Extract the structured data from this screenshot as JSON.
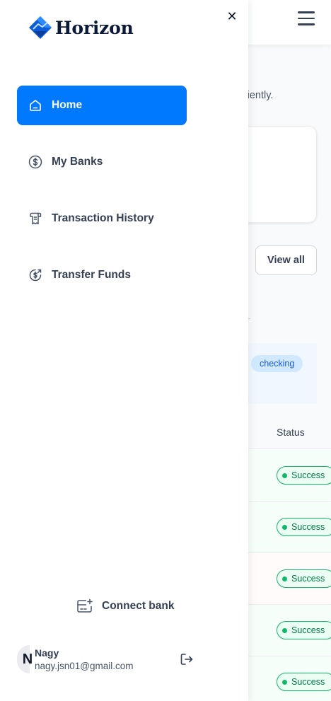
{
  "app": {
    "brand": "Horizon"
  },
  "background": {
    "subtitle_fragment": "s efficiently.",
    "view_all_label": "View all",
    "account_badge": "checking",
    "table_status_header": "Status",
    "rows": [
      {
        "status": "Success"
      },
      {
        "status": "Success"
      },
      {
        "status": "Success"
      },
      {
        "status": "Success"
      },
      {
        "status": "Success"
      }
    ]
  },
  "sidebar": {
    "items": [
      {
        "label": "Home",
        "icon": "home-icon",
        "active": true
      },
      {
        "label": "My Banks",
        "icon": "dollar-circle-icon",
        "active": false
      },
      {
        "label": "Transaction History",
        "icon": "receipt-icon",
        "active": false
      },
      {
        "label": "Transfer Funds",
        "icon": "money-send-icon",
        "active": false
      }
    ],
    "connect_bank_label": "Connect bank"
  },
  "user": {
    "initial": "N",
    "name": "Nagy",
    "email": "nagy.jsn01@gmail.com"
  },
  "colors": {
    "accent": "#0179fe",
    "success": "#12b76a",
    "text": "#344054"
  }
}
